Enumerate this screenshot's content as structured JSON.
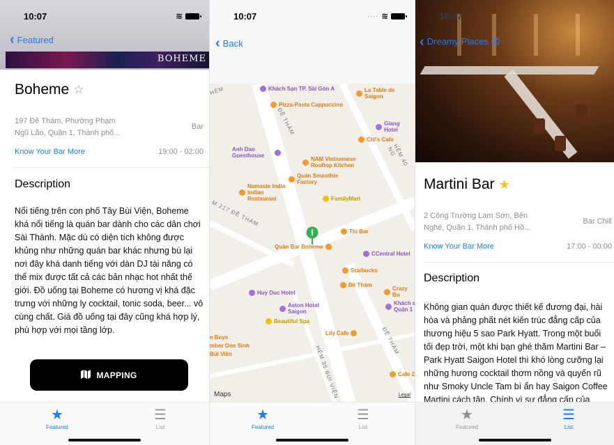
{
  "status_time": "10:07",
  "screens": [
    {
      "back_label": "Featured",
      "banner_logo": "BOHEME",
      "title": "Boheme",
      "address": "197 Đề Thám, Phường Phạm Ngũ Lão, Quận 1, Thành phố...",
      "address_line1": "197 Đề Thám, Phường Phạm",
      "address_line2": "Ngũ Lão, Quận 1, Thành phố...",
      "category": "Bar",
      "know_more": "Know Your Bar More",
      "hours": "19:00 - 02:00",
      "description_heading": "Description",
      "description": "Nổi tiếng trên con phố Tây Bùi Viện, Boheme khá nổi tiếng là quán bar dành cho các dân chơi Sài Thành. Mặc dù có diện tích không được khủng như những quán bar khác nhưng bù lại nơi đây khá danh tiếng với dàn DJ tài năng có thể mix được tất cả các bản nhạc hot nhất thế giới. Đồ uống tại Boheme có hương vị khá đặc trưng với những ly cocktail, tonic soda, beer... vô cùng chất. Giá đồ uống tại đây cũng khá hợp lý, phù hợp với mọi tầng lớp.",
      "mapping_button": "MAPPING"
    },
    {
      "back_label": "Back",
      "map": {
        "pois": [
          {
            "label": "Khách Sạn TP. Sài Gòn A",
            "color": "purple"
          },
          {
            "label": "Pizza-Pasta Cappuccino",
            "color": "orange"
          },
          {
            "label": "La Table de Saigon",
            "color": "orange"
          },
          {
            "label": "Giang Hotel",
            "color": "purple"
          },
          {
            "label": "Chi's Cafe",
            "color": "orange"
          },
          {
            "label": "Anh Dao Guesthouse",
            "color": "purple"
          },
          {
            "label": "NAM Vietnamese Rooftop Kitchen",
            "color": "orange"
          },
          {
            "label": "Quán Smoothie Factory",
            "color": "orange"
          },
          {
            "label": "Namaste India Indian Restaurant",
            "color": "orange"
          },
          {
            "label": "FamilyMart",
            "color": "yellow"
          },
          {
            "label": "Thi Bar",
            "color": "orange"
          },
          {
            "label": "Quán Bar Boheme",
            "color": "orange"
          },
          {
            "label": "CCentral Hotel",
            "color": "purple"
          },
          {
            "label": "Starbucks",
            "color": "orange"
          },
          {
            "label": "Đề Thám",
            "color": "orange"
          },
          {
            "label": "Crazy Bu",
            "color": "orange"
          },
          {
            "label": "Huy Duc Hotel",
            "color": "purple"
          },
          {
            "label": "Aston Hotel Saigon",
            "color": "purple"
          },
          {
            "label": "Khách s Quận 1",
            "color": "purple"
          },
          {
            "label": "Beautiful Spa",
            "color": "yellow"
          },
          {
            "label": "Lily Cafe",
            "color": "orange"
          },
          {
            "label": "e Boys",
            "color": "orange"
          },
          {
            "label": "mber One Sinh",
            "color": "orange"
          },
          {
            "label": "Bùi Viện",
            "color": "orange"
          },
          {
            "label": "Cafe 2",
            "color": "orange"
          }
        ],
        "streets": [
          "ĐỀ THÁM",
          "M 217 ĐỀ THÁM",
          "HẺM 40 NG",
          "HẺM",
          "ĐỀ THÁM",
          "HẺM 35 BÙI VIỆN"
        ],
        "maps_logo": "Maps",
        "legal": "Legal"
      }
    },
    {
      "back_label": "Dreamy Places 😊",
      "title": "Martini Bar",
      "address_line1": "2 Công Trường Lam Sơn, Bến",
      "address_line2": "Nghé, Quận 1, Thành phố Hồ...",
      "category": "Bar Chill",
      "know_more": "Know Your Bar More",
      "hours": "17:00 - 00:00",
      "description_heading": "Description",
      "description": "Không gian quán được thiết kế đương đại, hài hòa và phảng phất nét kiến trúc đẳng cấp của thương hiệu 5 sao Park Hyatt. Trong một buổi tối đẹp trời, một khi bạn ghé thăm Martini Bar – Park Hyatt Saigon Hotel thì khó lòng cưỡng lại những hương cocktail thơm nồng và quyến rũ như Smoky Uncle Tam bí ẩn hay Saigon Coffee Martini cách tân. Chính vì sự đẳng cấp của"
    }
  ],
  "tabbar": {
    "featured": "Featured",
    "list": "List"
  },
  "colors": {
    "accent": "#1b7cf5",
    "star_gold": "#f4c517"
  }
}
